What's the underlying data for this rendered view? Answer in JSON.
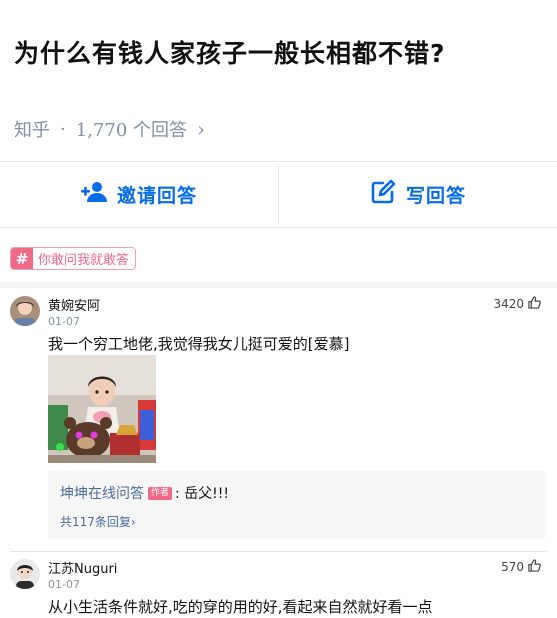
{
  "question": {
    "title": "为什么有钱人家孩子一般长相都不错?",
    "source": "知乎",
    "dot": "·",
    "answer_count": "1,770 个回答",
    "chevron": "›"
  },
  "actions": {
    "invite_label": "邀请回答",
    "invite_icon": "add-user-icon",
    "write_label": "写回答",
    "write_icon": "edit-icon",
    "accent": "#056de8"
  },
  "topic": {
    "hash": "#",
    "label": "你敢问我就敢答",
    "color": "#f06a87"
  },
  "comments": [
    {
      "author": "黄婉安阿",
      "date": "01-07",
      "likes": "3420",
      "content": "我一个穷工地佬,我觉得我女儿挺可爱的[爱慕]",
      "reply": {
        "author": "坤坤在线问答",
        "tag": "作者",
        "text": ": 岳父!!!",
        "more": "共117条回复›"
      }
    },
    {
      "author": "江苏Nuguri",
      "date": "01-07",
      "likes": "570",
      "content": "从小生活条件就好,吃的穿的用的好,看起来自然就好看一点"
    }
  ]
}
